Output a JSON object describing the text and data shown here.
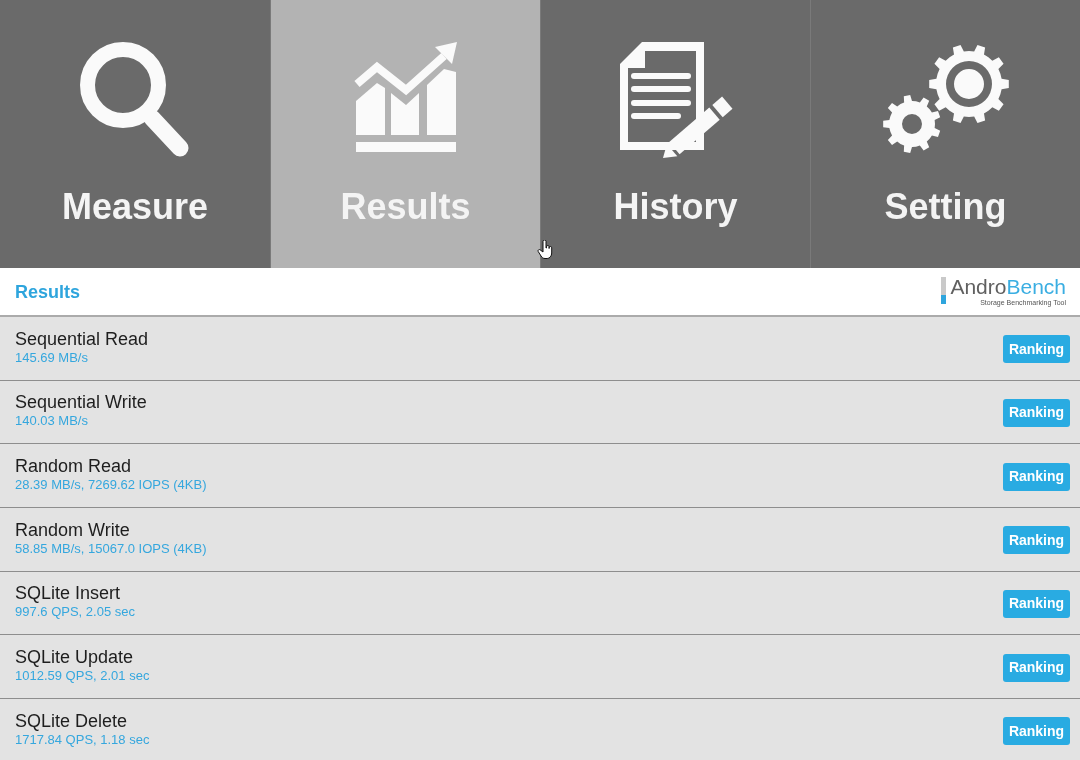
{
  "tabs": [
    {
      "label": "Measure",
      "kind": "search",
      "selected": false
    },
    {
      "label": "Results",
      "kind": "chart",
      "selected": true
    },
    {
      "label": "History",
      "kind": "document",
      "selected": false
    },
    {
      "label": "Setting",
      "kind": "gears",
      "selected": false
    }
  ],
  "header": {
    "title": "Results",
    "logo": {
      "brand_first": "Andro",
      "brand_second": "Bench",
      "tagline": "Storage Benchmarking Tool"
    }
  },
  "results": [
    {
      "name": "Sequential Read",
      "value": "145.69 MB/s",
      "button": "Ranking"
    },
    {
      "name": "Sequential Write",
      "value": "140.03 MB/s",
      "button": "Ranking"
    },
    {
      "name": "Random Read",
      "value": "28.39 MB/s, 7269.62 IOPS (4KB)",
      "button": "Ranking"
    },
    {
      "name": "Random Write",
      "value": "58.85 MB/s, 15067.0 IOPS (4KB)",
      "button": "Ranking"
    },
    {
      "name": "SQLite Insert",
      "value": "997.6 QPS, 2.05 sec",
      "button": "Ranking"
    },
    {
      "name": "SQLite Update",
      "value": "1012.59 QPS, 2.01 sec",
      "button": "Ranking"
    },
    {
      "name": "SQLite Delete",
      "value": "1717.84 QPS, 1.18 sec",
      "button": "Ranking"
    }
  ]
}
